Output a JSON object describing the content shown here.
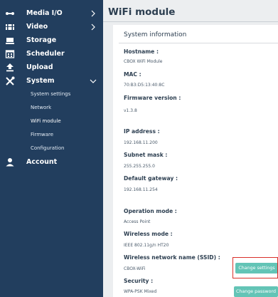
{
  "sidebar": {
    "items": [
      {
        "label": "Media I/O",
        "icon": "media-io-icon",
        "chevron": "right"
      },
      {
        "label": "Video",
        "icon": "video-icon",
        "chevron": "right"
      },
      {
        "label": "Storage",
        "icon": "storage-icon"
      },
      {
        "label": "Scheduler",
        "icon": "calendar-icon"
      },
      {
        "label": "Upload",
        "icon": "upload-icon"
      },
      {
        "label": "System",
        "icon": "tools-icon",
        "chevron": "down"
      },
      {
        "label": "Account",
        "icon": "user-icon"
      }
    ],
    "system_sub": [
      "System settings",
      "Network",
      "WiFi module",
      "Firmware",
      "Configuration"
    ],
    "active_sub": "WiFi module"
  },
  "page": {
    "title": "WiFi module"
  },
  "card": {
    "title": "System information",
    "fields": {
      "hostname": {
        "label": "Hostname :",
        "value": "CBOX WiFi Module"
      },
      "mac": {
        "label": "MAC :",
        "value": "70:B3:D5:13:40:8C"
      },
      "firmware": {
        "label": "Firmware version :",
        "value": "v1.3.8"
      },
      "ip": {
        "label": "IP address :",
        "value": "192.168.11.200"
      },
      "subnet": {
        "label": "Subnet mask :",
        "value": "255.255.255.0"
      },
      "gateway": {
        "label": "Default gateway :",
        "value": "192.168.11.254"
      },
      "mode": {
        "label": "Operation mode :",
        "value": "Access Point"
      },
      "wmode": {
        "label": "Wireless mode :",
        "value": "IEEE 802.11g/n HT20"
      },
      "ssid": {
        "label": "Wireless network name (SSID) :",
        "value": "CBOX-WiFi"
      },
      "security": {
        "label": "Security :",
        "value": "WPA-PSK Mixed"
      }
    },
    "buttons": {
      "change_settings": "Change settings",
      "change_password": "Change password"
    }
  },
  "colors": {
    "sidebar_bg": "#223e5e",
    "accent": "#63c4b6",
    "highlight": "#d9302a",
    "main_bg": "#eceef0"
  }
}
